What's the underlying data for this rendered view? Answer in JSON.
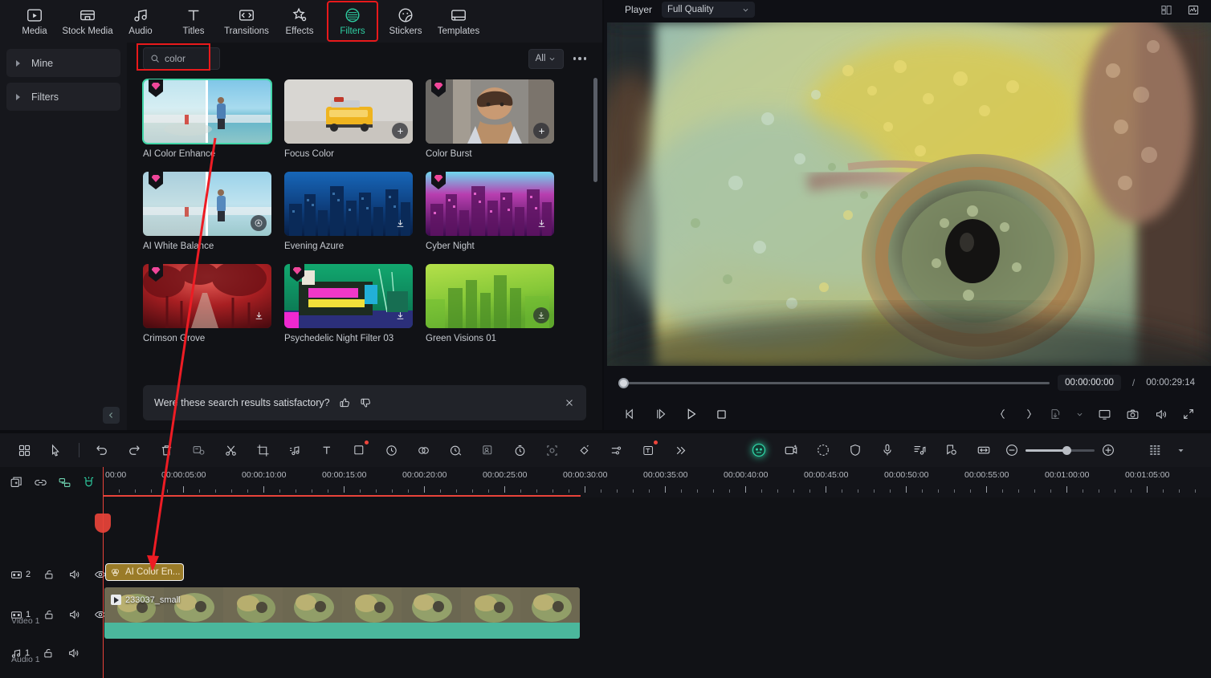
{
  "topnav": {
    "items": [
      {
        "label": "Media",
        "icon": "media-icon",
        "active": false
      },
      {
        "label": "Stock Media",
        "icon": "stock-media-icon",
        "active": false
      },
      {
        "label": "Audio",
        "icon": "audio-icon",
        "active": false
      },
      {
        "label": "Titles",
        "icon": "titles-icon",
        "active": false
      },
      {
        "label": "Transitions",
        "icon": "transitions-icon",
        "active": false
      },
      {
        "label": "Effects",
        "icon": "effects-icon",
        "active": false
      },
      {
        "label": "Filters",
        "icon": "filters-icon",
        "active": true
      },
      {
        "label": "Stickers",
        "icon": "stickers-icon",
        "active": false
      },
      {
        "label": "Templates",
        "icon": "templates-icon",
        "active": false
      }
    ]
  },
  "sidebar": {
    "items": [
      {
        "label": "Mine"
      },
      {
        "label": "Filters"
      }
    ]
  },
  "search": {
    "value": "color",
    "placeholder": "Search",
    "icon": "search-icon"
  },
  "filter_bar": {
    "dropdown_value": "All",
    "more_label": "more-options"
  },
  "results": {
    "cards": [
      {
        "title": "AI Color Enhance",
        "badge": "premium-gem",
        "action": "none",
        "selected": true
      },
      {
        "title": "Focus Color",
        "badge": "none",
        "action": "add",
        "selected": false
      },
      {
        "title": "Color Burst",
        "badge": "premium-gem",
        "action": "add",
        "selected": false
      },
      {
        "title": "AI White Balance",
        "badge": "premium-gem",
        "action": "ai",
        "selected": false
      },
      {
        "title": "Evening Azure",
        "badge": "none",
        "action": "download",
        "selected": false
      },
      {
        "title": "Cyber Night",
        "badge": "premium-gem",
        "action": "download",
        "selected": false
      },
      {
        "title": "Crimson Grove",
        "badge": "premium-gem",
        "action": "download",
        "selected": false
      },
      {
        "title": "Psychedelic Night Filter 03",
        "badge": "premium-gem",
        "action": "download",
        "selected": false
      },
      {
        "title": "Green Visions 01",
        "badge": "none",
        "action": "download",
        "selected": false
      }
    ]
  },
  "feedback": {
    "question": "Were these search results satisfactory?",
    "thumbs_up": "thumbs-up-icon",
    "thumbs_down": "thumbs-down-icon",
    "close": "close-icon"
  },
  "player": {
    "title": "Player",
    "quality": "Full Quality",
    "current_time": "00:00:00:00",
    "separator": "/",
    "total_time": "00:00:29:14",
    "header_icons": [
      "layout-grid-icon",
      "waveform-icon"
    ],
    "transport_icons": [
      "prev-frame-icon",
      "next-frame-icon",
      "play-icon",
      "stop-icon"
    ],
    "right_icons": [
      "mark-in-icon",
      "mark-out-icon",
      "export-frame-icon",
      "chevron-down-icon",
      "screen-record-icon",
      "snapshot-icon",
      "volume-icon",
      "fullscreen-icon"
    ]
  },
  "timeline_toolbar": {
    "left_icons": [
      "apps-grid-icon",
      "select-tool-icon"
    ],
    "edit_icons": [
      "undo-icon",
      "redo-icon",
      "delete-icon"
    ],
    "tool_icons": [
      "split-view-icon",
      "scissors-icon",
      "crop-icon",
      "audio-detach-icon",
      "text-icon",
      "mask-icon",
      "speed-icon",
      "color-match-icon",
      "ai-tools-icon",
      "smart-cutout-icon",
      "stopwatch-icon",
      "motion-track-icon",
      "keyframe-icon",
      "adjust-icon",
      "ai-text-icon",
      "more-tools-icon"
    ],
    "ai_icons": [
      "ai-portrait-icon",
      "ai-camera-icon",
      "record-icon",
      "shield-icon",
      "mic-icon",
      "audio-mix-icon",
      "marker-icon",
      "fit-timeline-icon"
    ],
    "zoom": {
      "out": "zoom-out-icon",
      "in": "zoom-in-icon",
      "level": 55
    },
    "right_icons": [
      "grid-view-icon",
      "chevron-down-icon"
    ]
  },
  "timeline": {
    "track_tools": [
      "add-track-icon",
      "link-icon",
      "group-icon",
      "magnet-icon"
    ],
    "ruler_labels": [
      "00:00",
      "00:00:05:00",
      "00:00:10:00",
      "00:00:15:00",
      "00:00:20:00",
      "00:00:25:00",
      "00:00:30:00",
      "00:00:35:00",
      "00:00:40:00",
      "00:00:45:00",
      "00:00:50:00",
      "00:00:55:00",
      "00:01:00:00",
      "00:01:05:00"
    ],
    "tracks": [
      {
        "index": "2",
        "type": "video",
        "name": "",
        "icons": [
          "video-track-icon",
          "lock-icon",
          "mute-icon",
          "eye-icon"
        ]
      },
      {
        "index": "1",
        "type": "video",
        "name": "Video 1",
        "icons": [
          "video-track-icon",
          "lock-icon",
          "mute-icon",
          "eye-icon"
        ]
      },
      {
        "index": "1",
        "type": "audio",
        "name": "Audio 1",
        "icons": [
          "audio-track-icon",
          "lock-icon",
          "mute-icon"
        ]
      }
    ],
    "clips": [
      {
        "kind": "filter",
        "label": "AI Color En...",
        "icon": "filter-clip-icon"
      },
      {
        "kind": "video",
        "label": "233037_small",
        "icon": "play-clip-icon"
      }
    ]
  },
  "annotations": {
    "highlight_color": "#e8191b",
    "accent_color": "#2ecfa2",
    "selected_border": "#42d6a8"
  }
}
